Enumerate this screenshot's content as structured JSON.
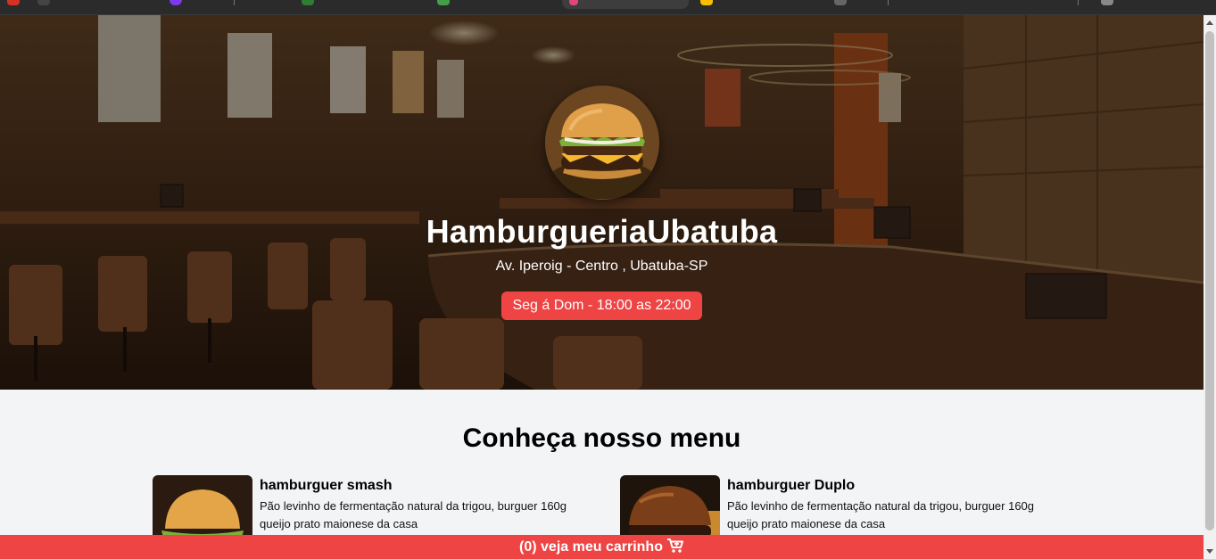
{
  "restaurant": {
    "name": "HamburgueriaUbatuba",
    "address": "Av. Iperoig - Centro , Ubatuba-SP",
    "hours": "Seg á Dom - 18:00 as 22:00"
  },
  "menu": {
    "title": "Conheça nosso menu",
    "items": [
      {
        "name": "hamburguer smash",
        "description": "Pão levinho de fermentação natural da trigou, burguer 160g queijo prato maionese da casa"
      },
      {
        "name": "hamburguer Duplo",
        "description": "Pão levinho de fermentação natural da trigou, burguer 160g queijo prato maionese da casa"
      }
    ]
  },
  "cart": {
    "label": "(0) veja meu carrinho",
    "icon": "cart-plus-icon"
  },
  "colors": {
    "accent": "#ef4444",
    "page_bg": "#f3f4f6"
  }
}
